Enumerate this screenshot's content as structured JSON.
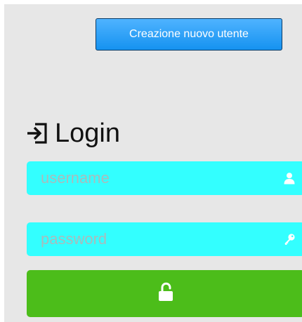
{
  "header": {
    "create_user_label": "Creazione nuovo utente"
  },
  "login": {
    "title": "Login",
    "icon": "sign-in-icon",
    "username": {
      "placeholder": "username",
      "value": "",
      "icon": "user-icon"
    },
    "password": {
      "placeholder": "password",
      "value": "",
      "icon": "key-icon"
    },
    "submit_icon": "unlock-icon"
  },
  "colors": {
    "panel_background": "#e7e7e7",
    "create_button": "#1592f0",
    "input_background": "#33ffff",
    "login_button": "#4cbd1a"
  }
}
